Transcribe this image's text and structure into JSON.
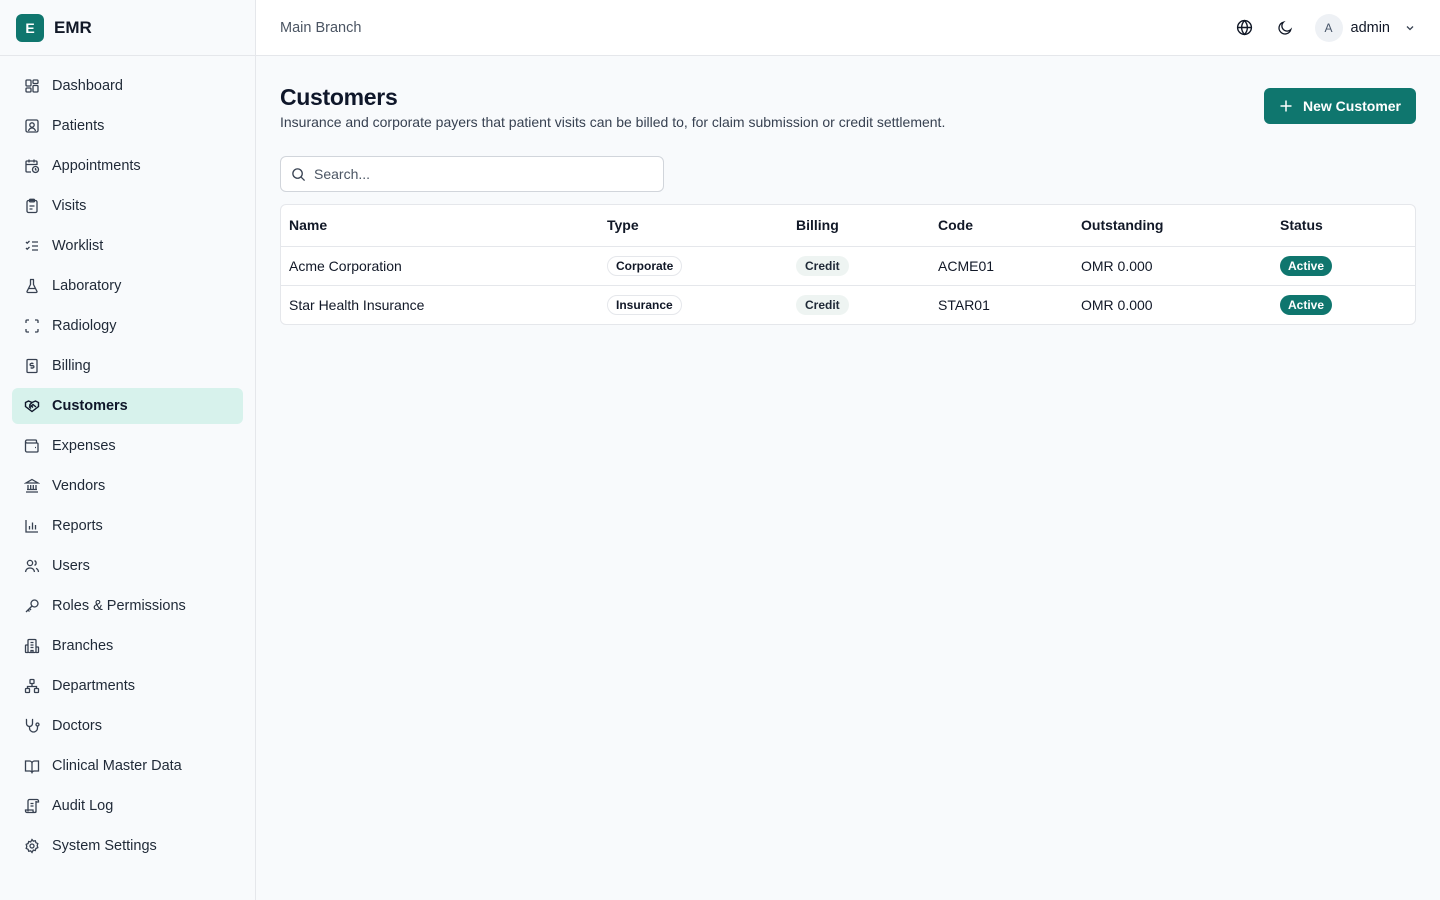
{
  "brand": {
    "logo_letter": "E",
    "name": "EMR"
  },
  "sidebar": {
    "items": [
      {
        "label": "Dashboard",
        "icon": "dashboard-icon"
      },
      {
        "label": "Patients",
        "icon": "patient-icon"
      },
      {
        "label": "Appointments",
        "icon": "calendar-clock-icon"
      },
      {
        "label": "Visits",
        "icon": "clipboard-icon"
      },
      {
        "label": "Worklist",
        "icon": "list-checks-icon"
      },
      {
        "label": "Laboratory",
        "icon": "flask-icon"
      },
      {
        "label": "Radiology",
        "icon": "scan-icon"
      },
      {
        "label": "Billing",
        "icon": "receipt-icon"
      },
      {
        "label": "Customers",
        "icon": "handshake-icon",
        "active": true
      },
      {
        "label": "Expenses",
        "icon": "wallet-icon"
      },
      {
        "label": "Vendors",
        "icon": "landmark-icon"
      },
      {
        "label": "Reports",
        "icon": "bar-chart-icon"
      },
      {
        "label": "Users",
        "icon": "users-icon"
      },
      {
        "label": "Roles & Permissions",
        "icon": "key-icon"
      },
      {
        "label": "Branches",
        "icon": "building-icon"
      },
      {
        "label": "Departments",
        "icon": "network-icon"
      },
      {
        "label": "Doctors",
        "icon": "stethoscope-icon"
      },
      {
        "label": "Clinical Master Data",
        "icon": "book-icon"
      },
      {
        "label": "Audit Log",
        "icon": "scroll-icon"
      },
      {
        "label": "System Settings",
        "icon": "gear-icon"
      }
    ]
  },
  "topbar": {
    "branch": "Main Branch",
    "user": {
      "avatar_letter": "A",
      "name": "admin"
    }
  },
  "page": {
    "title": "Customers",
    "subtitle": "Insurance and corporate payers that patient visits can be billed to, for claim submission or credit settlement.",
    "new_button": "New Customer"
  },
  "search": {
    "placeholder": "Search...",
    "value": ""
  },
  "table": {
    "columns": [
      "Name",
      "Type",
      "Billing",
      "Code",
      "Outstanding",
      "Status"
    ],
    "rows": [
      {
        "name": "Acme Corporation",
        "type": "Corporate",
        "billing": "Credit",
        "code": "ACME01",
        "outstanding": "OMR 0.000",
        "status": "Active"
      },
      {
        "name": "Star Health Insurance",
        "type": "Insurance",
        "billing": "Credit",
        "code": "STAR01",
        "outstanding": "OMR 0.000",
        "status": "Active"
      }
    ]
  },
  "colors": {
    "accent": "#0f766e",
    "active_nav_bg": "#d7f2ec"
  }
}
